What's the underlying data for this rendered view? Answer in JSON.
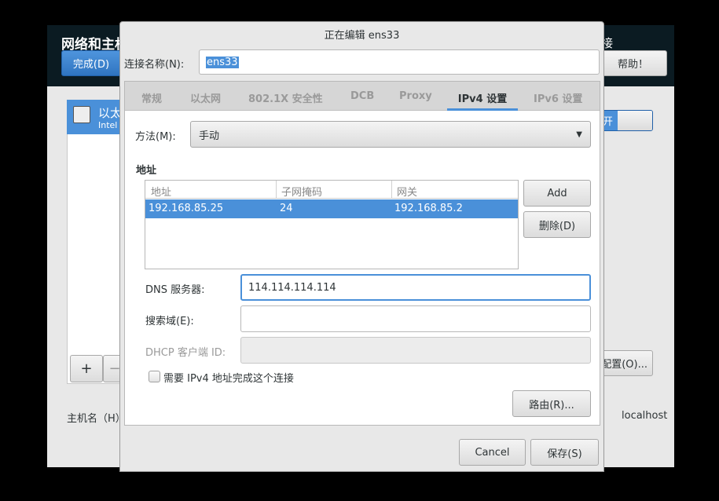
{
  "background": {
    "title": "网络和主机名",
    "done_label": "完成(D)",
    "help_label": "帮助！",
    "header_right_fragment": "接",
    "device_name": "以太",
    "device_desc": "Intel",
    "toggle_label": "开",
    "add_label": "+",
    "remove_label": "−",
    "configure_label": "配置(O)...",
    "hostname_label": "主机名（H）",
    "hostname_colon": ":",
    "hostname_value": "localhost"
  },
  "dialog": {
    "title": "正在编辑 ens33",
    "conn_name_label": "连接名称(N):",
    "conn_name_value": "ens33",
    "tabs": [
      {
        "label": "常规"
      },
      {
        "label": "以太网"
      },
      {
        "label": "802.1X 安全性"
      },
      {
        "label": "DCB"
      },
      {
        "label": "Proxy"
      },
      {
        "label": "IPv4 设置",
        "active": true
      },
      {
        "label": "IPv6 设置"
      }
    ],
    "method_label": "方法(M):",
    "method_value": "手动",
    "address_heading": "地址",
    "table": {
      "headers": [
        "地址",
        "子网掩码",
        "网关"
      ],
      "rows": [
        [
          "192.168.85.25",
          "24",
          "192.168.85.2"
        ]
      ]
    },
    "add_label": "Add",
    "delete_label": "删除(D)",
    "dns_label": "DNS 服务器:",
    "dns_value": "114.114.114.114",
    "search_label": "搜索域(E):",
    "search_value": "",
    "dhcp_label": "DHCP 客户端 ID:",
    "dhcp_value": "",
    "require_ipv4_label": "需要 IPv4 地址完成这个连接",
    "require_ipv4_checked": false,
    "routes_label": "路由(R)...",
    "cancel_label": "Cancel",
    "save_label": "保存(S)"
  },
  "colors": {
    "accent": "#4a90d9",
    "header_bg": "#0b1b22"
  }
}
